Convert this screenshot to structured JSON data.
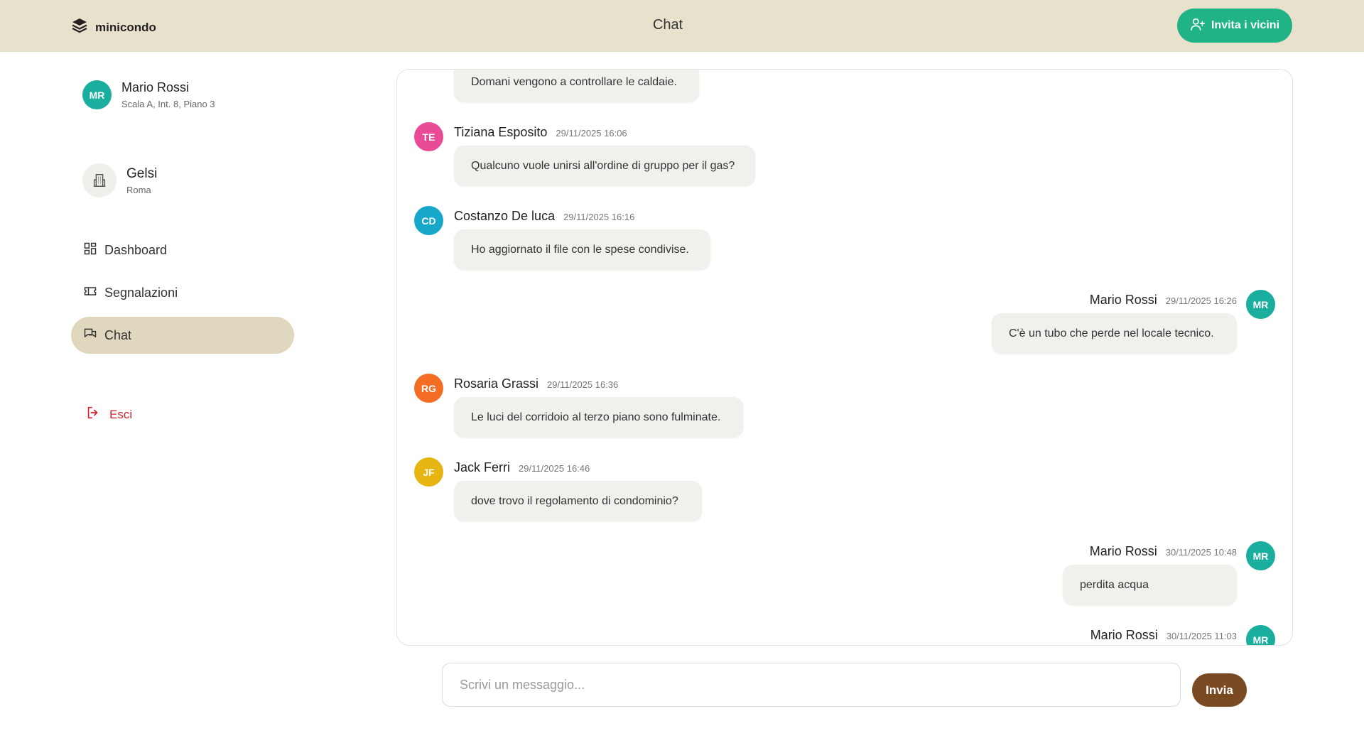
{
  "header": {
    "brand": "minicondo",
    "title": "Chat",
    "invite_label": "Invita i vicini",
    "invite_color": "#1fb386"
  },
  "user": {
    "initials": "MR",
    "name": "Mario Rossi",
    "address": "Scala A, Int. 8, Piano 3",
    "avatar_color": "#1aae9f"
  },
  "building": {
    "name": "Gelsi",
    "city": "Roma"
  },
  "nav": [
    {
      "label": "Dashboard",
      "icon": "dashboard-icon",
      "active": false
    },
    {
      "label": "Segnalazioni",
      "icon": "ticket-icon",
      "active": false
    },
    {
      "label": "Chat",
      "icon": "chat-icon",
      "active": true
    }
  ],
  "logout_label": "Esci",
  "messages": [
    {
      "own": false,
      "initials": "",
      "sender": "",
      "time": "",
      "text": "Domani vengono a controllare le caldaie.",
      "color": ""
    },
    {
      "own": false,
      "initials": "TE",
      "sender": "Tiziana Esposito",
      "time": "29/11/2025 16:06",
      "text": "Qualcuno vuole unirsi all'ordine di gruppo per il gas?",
      "color": "#e94b97"
    },
    {
      "own": false,
      "initials": "CD",
      "sender": "Costanzo De luca",
      "time": "29/11/2025 16:16",
      "text": "Ho aggiornato il file con le spese condivise.",
      "color": "#16a7c9"
    },
    {
      "own": true,
      "initials": "MR",
      "sender": "Mario Rossi",
      "time": "29/11/2025 16:26",
      "text": "C'è un tubo che perde nel locale tecnico.",
      "color": "#1aae9f"
    },
    {
      "own": false,
      "initials": "RG",
      "sender": "Rosaria Grassi",
      "time": "29/11/2025 16:36",
      "text": "Le luci del corridoio al terzo piano sono fulminate.",
      "color": "#f36d24"
    },
    {
      "own": false,
      "initials": "JF",
      "sender": "Jack Ferri",
      "time": "29/11/2025 16:46",
      "text": "dove trovo il regolamento di condominio?",
      "color": "#e6b512"
    },
    {
      "own": true,
      "initials": "MR",
      "sender": "Mario Rossi",
      "time": "30/11/2025 10:48",
      "text": "perdita acqua",
      "color": "#1aae9f"
    },
    {
      "own": true,
      "initials": "MR",
      "sender": "Mario Rossi",
      "time": "30/11/2025 11:03",
      "text": "",
      "color": "#1aae9f"
    }
  ],
  "composer": {
    "placeholder": "Scrivi un messaggio...",
    "value": "",
    "send_label": "Invia",
    "send_color": "#7a4a22"
  }
}
